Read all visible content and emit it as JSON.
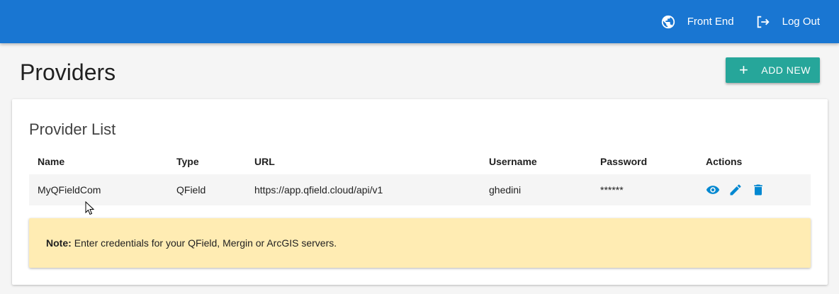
{
  "header": {
    "front_end_label": "Front End",
    "log_out_label": "Log Out",
    "front_end_icon": "globe-icon",
    "log_out_icon": "logout-icon",
    "bar_color": "#1976d2"
  },
  "page": {
    "title": "Providers",
    "add_button_label": "ADD NEW",
    "add_button_icon": "plus-icon",
    "add_button_color": "#26a69a"
  },
  "card": {
    "title": "Provider List",
    "columns": [
      "Name",
      "Type",
      "URL",
      "Username",
      "Password",
      "Actions"
    ],
    "rows": [
      {
        "name": "MyQFieldCom",
        "type": "QField",
        "url": "https://app.qfield.cloud/api/v1",
        "username": "ghedini",
        "password": "******",
        "actions": [
          "eye-icon",
          "pencil-icon",
          "trash-icon"
        ]
      }
    ],
    "action_color": "#0288d1"
  },
  "note": {
    "label": "Note:",
    "text": "Enter credentials for your QField, Mergin or ArcGIS servers.",
    "color": "#ffecb3"
  }
}
